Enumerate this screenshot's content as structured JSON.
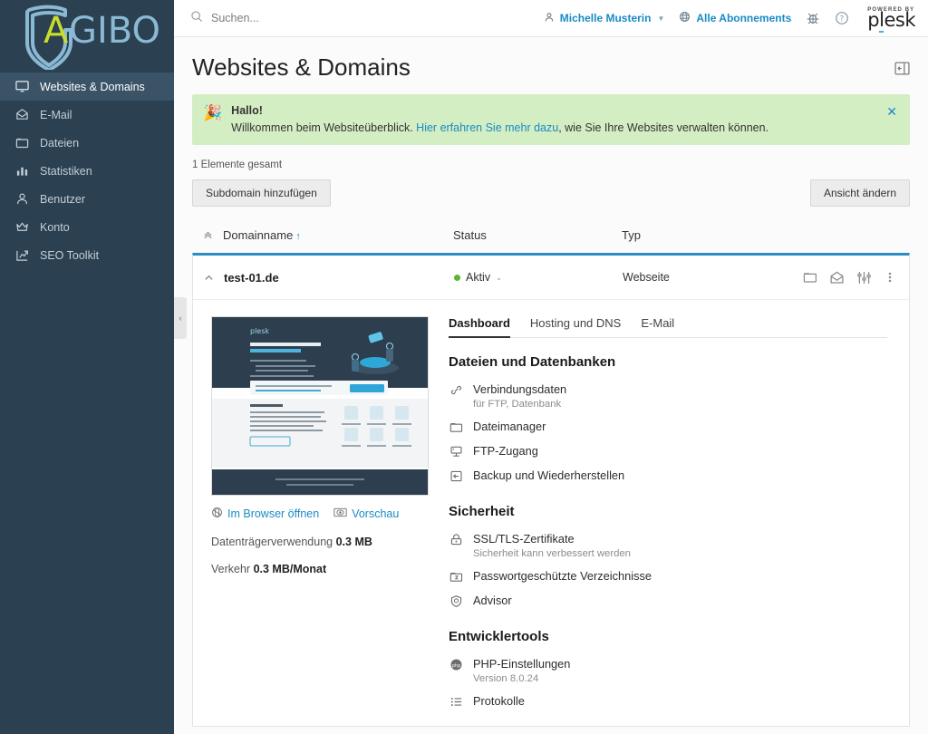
{
  "brand": {
    "logo_text_a": "A",
    "logo_text_rest": "GIBO",
    "logo_color_a": "#c8dd2d",
    "logo_color_rest": "#8ab9d4",
    "sidebar_bg": "#2b4050",
    "accent": "#1a8bc4"
  },
  "sidebar": {
    "items": [
      {
        "label": "Websites & Domains",
        "icon": "monitor-icon",
        "active": true
      },
      {
        "label": "E-Mail",
        "icon": "envelope-icon",
        "active": false
      },
      {
        "label": "Dateien",
        "icon": "folder-icon",
        "active": false
      },
      {
        "label": "Statistiken",
        "icon": "bar-chart-icon",
        "active": false
      },
      {
        "label": "Benutzer",
        "icon": "user-icon",
        "active": false
      },
      {
        "label": "Konto",
        "icon": "crown-icon",
        "active": false
      },
      {
        "label": "SEO Toolkit",
        "icon": "trending-arrow-icon",
        "active": false
      }
    ]
  },
  "topbar": {
    "search_placeholder": "Suchen...",
    "user_name": "Michelle Musterin",
    "subscriptions_label": "Alle Abonnements",
    "bug_icon": "bug-icon",
    "help_icon": "question-circle-icon",
    "powered_by": "POWERED BY",
    "plesk_p": "p",
    "plesk_l": "l",
    "plesk_esk": "esk"
  },
  "page": {
    "title": "Websites & Domains",
    "panel_toggle_icon": "panel-collapse-icon"
  },
  "banner": {
    "emoji": "🎉",
    "title": "Hallo!",
    "text_before": "Willkommen beim Websiteüberblick. ",
    "link": "Hier erfahren Sie mehr dazu",
    "text_after": ", wie Sie Ihre Websites verwalten können.",
    "close": "✕",
    "bg_color": "#d4eec4"
  },
  "toolbar": {
    "total_label": "1 Elemente gesamt",
    "add_subdomain_label": "Subdomain hinzufügen",
    "change_view_label": "Ansicht ändern"
  },
  "table": {
    "collapse_icon": "chevron-double-up-icon",
    "headers": {
      "domain": "Domainname",
      "sort_arrow": "↑",
      "status": "Status",
      "typ": "Typ"
    }
  },
  "domain_row": {
    "collapse_caret": "⌃",
    "name": "test-01.de",
    "status": "Aktiv",
    "status_color": "#5cb531",
    "status_caret": "⌄",
    "typ": "Webseite",
    "actions": [
      {
        "icon": "folder-icon",
        "name": "file-manager-action"
      },
      {
        "icon": "envelope-icon",
        "name": "mail-action"
      },
      {
        "icon": "sliders-icon",
        "name": "settings-action"
      },
      {
        "icon": "dots-vertical-icon",
        "name": "more-menu-action"
      }
    ]
  },
  "preview": {
    "thumbnail_alt": "plesk-default-page-thumbnail",
    "open_browser_label": "Im Browser öffnen",
    "preview_label": "Vorschau",
    "disk_label": "Datenträgerverwendung",
    "disk_value": "0.3 MB",
    "traffic_label": "Verkehr",
    "traffic_value": "0.3 MB/Monat"
  },
  "detail_tabs": [
    {
      "label": "Dashboard",
      "active": true
    },
    {
      "label": "Hosting und DNS",
      "active": false
    },
    {
      "label": "E-Mail",
      "active": false
    }
  ],
  "sections": [
    {
      "title": "Dateien und Datenbanken",
      "items": [
        {
          "label": "Verbindungsdaten",
          "sub": "für FTP, Datenbank",
          "icon": "link-icon"
        },
        {
          "label": "Dateimanager",
          "sub": "",
          "icon": "folder-icon"
        },
        {
          "label": "FTP-Zugang",
          "sub": "",
          "icon": "server-icon"
        },
        {
          "label": "Backup und Wiederherstellen",
          "sub": "",
          "icon": "backup-icon"
        }
      ]
    },
    {
      "title": "Sicherheit",
      "items": [
        {
          "label": "SSL/TLS-Zertifikate",
          "sub": "Sicherheit kann verbessert werden",
          "icon": "lock-icon"
        },
        {
          "label": "Passwortgeschützte Verzeichnisse",
          "sub": "",
          "icon": "protected-folder-icon"
        },
        {
          "label": "Advisor",
          "sub": "",
          "icon": "shield-icon"
        }
      ]
    },
    {
      "title": "Entwicklertools",
      "items": [
        {
          "label": "PHP-Einstellungen",
          "sub": "Version 8.0.24",
          "icon": "php-icon"
        },
        {
          "label": "Protokolle",
          "sub": "",
          "icon": "list-icon"
        }
      ]
    }
  ],
  "side_handle": {
    "icon": "chevron-left-icon",
    "glyph": "‹"
  }
}
